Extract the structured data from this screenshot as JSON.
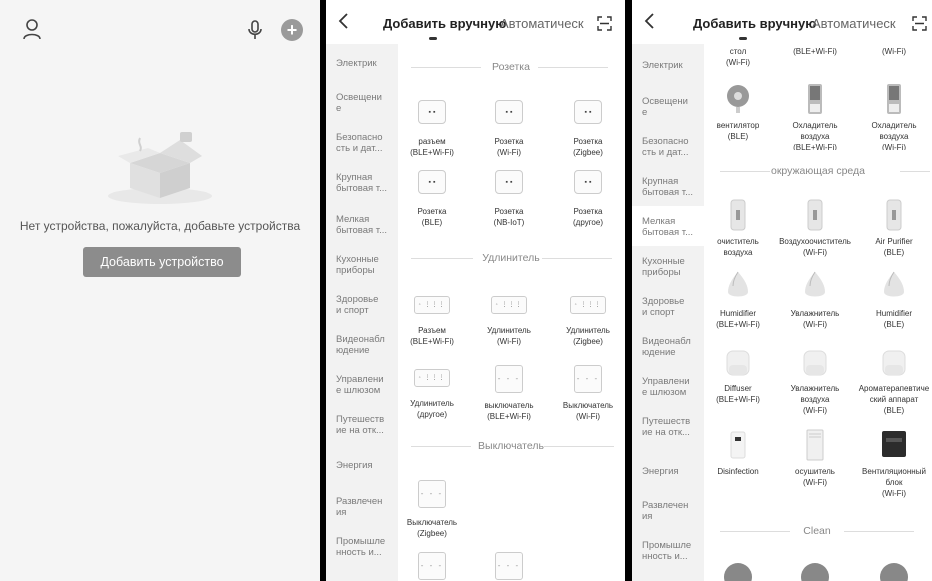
{
  "home": {
    "empty_text": "Нет устройства, пожалуйста, добавьте устройства",
    "add_button": "Добавить устройство"
  },
  "add_screen": {
    "tab_manual": "Добавить вручную",
    "tab_auto": "Автоматическ",
    "categories": [
      "Электрик",
      "Освещени е",
      "Безопасно сть и дат...",
      "Крупная бытовая т...",
      "Мелкая бытовая т...",
      "Кухонные приборы",
      "Здоровье и спорт",
      "Видеонабл юдение",
      "Управлени е шлюзом",
      "Путешеств ие на отк...",
      "Энергия",
      "Развлечен ия",
      "Промышле нность и..."
    ],
    "p2_categories": [
      "Электрик",
      "Освещени е",
      "Безопасно сть и дат...",
      "Крупная бытовая т...",
      "Мелкая бытовая т...",
      "Кухонные приборы",
      "Здоровье и спорт",
      "Видеонабл юдение",
      "Управлени е шлюзом",
      "Путешеств ие на отк...",
      "Энергия",
      "Развлечен ия",
      "Промышле нность и..."
    ]
  },
  "p2_sections": {
    "socket": "Розетка",
    "extender": "Удлинитель",
    "switch": "Выключатель"
  },
  "p2_devices": [
    {
      "label": "разъем\n(BLE+Wi-Fi)",
      "icon": "socket-icon"
    },
    {
      "label": "Розетка\n(Wi-Fi)",
      "icon": "socket-icon"
    },
    {
      "label": "Розетка\n(Zigbee)",
      "icon": "socket-icon"
    },
    {
      "label": "Розетка\n(BLE)",
      "icon": "socket-icon"
    },
    {
      "label": "Розетка\n(NB-IoT)",
      "icon": "socket-icon"
    },
    {
      "label": "Розетка\n(другое)",
      "icon": "socket-icon"
    },
    {
      "label": "Разъем\n(BLE+Wi-Fi)",
      "icon": "power-strip-icon"
    },
    {
      "label": "Удлинитель\n(Wi-Fi)",
      "icon": "power-strip-icon"
    },
    {
      "label": "Удлинитель\n(Zigbee)",
      "icon": "power-strip-icon"
    },
    {
      "label": "Удлинитель\n(другое)",
      "icon": "power-strip-icon"
    },
    {
      "label": "выключатель\n(BLE+Wi-Fi)",
      "icon": "switch-icon"
    },
    {
      "label": "Выключатель\n(Wi-Fi)",
      "icon": "switch-icon"
    },
    {
      "label": "Выключатель\n(Zigbee)",
      "icon": "switch-icon"
    }
  ],
  "p3_sections": {
    "environment": "окружающая среда",
    "clean": "Clean"
  },
  "p3_devices": [
    {
      "label": "стол\n(Wi-Fi)"
    },
    {
      "label": "(BLE+Wi-Fi)"
    },
    {
      "label": "(Wi-Fi)"
    },
    {
      "label": "вентилятор\n(BLE)"
    },
    {
      "label": "Охладитель\nвоздуха\n(BLE+Wi-Fi)"
    },
    {
      "label": "Охладитель\nвоздуха\n(Wi-Fi)"
    },
    {
      "label": "очиститель\nвоздуха\n(BLE+Wi-Fi)"
    },
    {
      "label": "Воздухоочиститель\n(Wi-Fi)"
    },
    {
      "label": "Air Purifier\n(BLE)"
    },
    {
      "label": "Humidifier\n(BLE+Wi-Fi)"
    },
    {
      "label": "Увлажнитель\n(Wi-Fi)"
    },
    {
      "label": "Humidifier\n(BLE)"
    },
    {
      "label": "Diffuser\n(BLE+Wi-Fi)"
    },
    {
      "label": "Увлажнитель\nвоздуха\n(Wi-Fi)"
    },
    {
      "label": "Ароматерапевтиче\nский аппарат\n(BLE)"
    },
    {
      "label": "Disinfection"
    },
    {
      "label": "осушитель\n(Wi-Fi)"
    },
    {
      "label": "Вентиляционный\nблок\n(Wi-Fi)"
    }
  ]
}
